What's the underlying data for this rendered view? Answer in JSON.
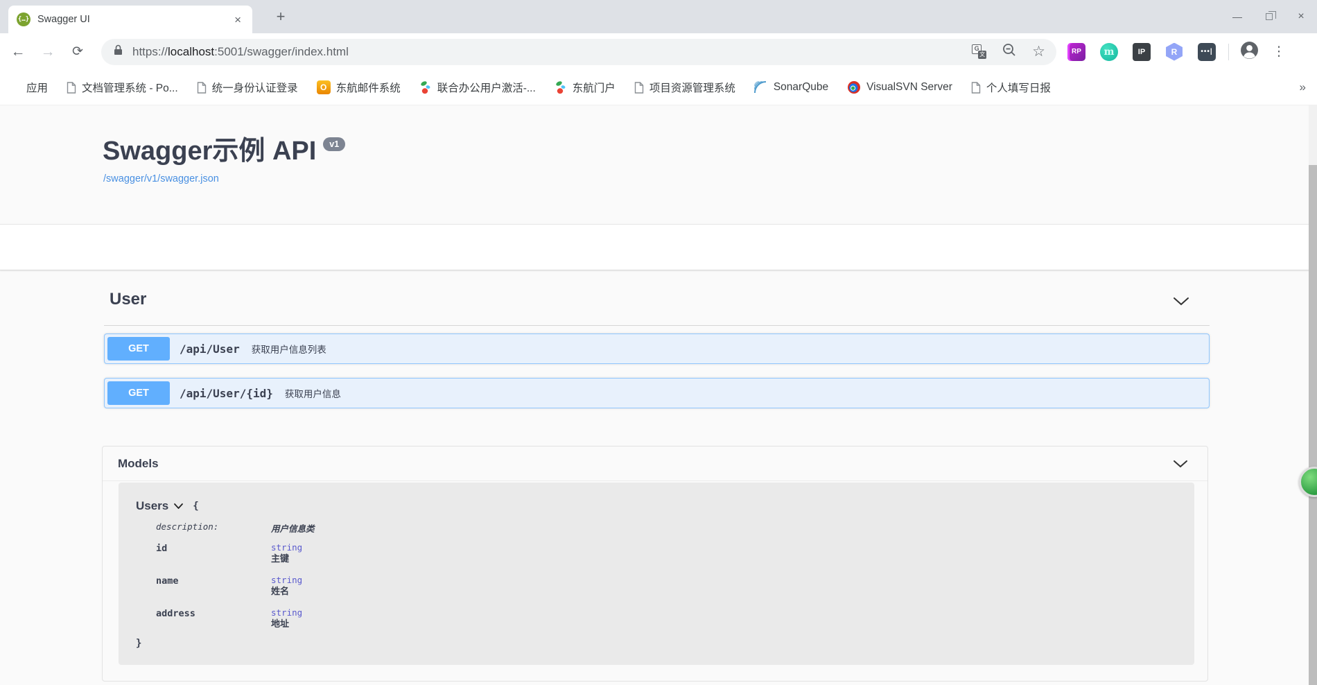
{
  "browser": {
    "tab_title": "Swagger UI",
    "url": {
      "scheme": "https://",
      "host": "localhost",
      "path": ":5001/swagger/index.html"
    },
    "bookmarks": [
      {
        "label": "应用",
        "icon": "apps-grid-icon"
      },
      {
        "label": "文档管理系统 - Po...",
        "icon": "page-icon"
      },
      {
        "label": "统一身份认证登录",
        "icon": "page-icon"
      },
      {
        "label": "东航邮件系统",
        "icon": "orange-o-icon"
      },
      {
        "label": "联合办公用户激活-...",
        "icon": "colorful-logo-icon"
      },
      {
        "label": "东航门户",
        "icon": "colorful-logo-icon"
      },
      {
        "label": "项目资源管理系统",
        "icon": "page-icon"
      },
      {
        "label": "SonarQube",
        "icon": "sonarqube-icon"
      },
      {
        "label": "VisualSVN Server",
        "icon": "visualsvn-icon"
      },
      {
        "label": "个人填写日报",
        "icon": "page-icon"
      }
    ],
    "extensions": [
      {
        "label": "RP"
      },
      {
        "label": "m"
      },
      {
        "label": "IP"
      },
      {
        "label": "R"
      },
      {
        "label": "•••|"
      }
    ]
  },
  "icons": {
    "swagger_glyph": "{…}",
    "close": "×",
    "plus": "+",
    "minimize": "—",
    "kebab": "⋮",
    "star": "☆",
    "back": "←",
    "forward": "→",
    "reload": "⟳",
    "overflow": "»"
  },
  "swagger": {
    "title": "Swagger示例 API",
    "version_badge": "v1",
    "spec_link": "/swagger/v1/swagger.json",
    "tag": {
      "name": "User"
    },
    "operations": [
      {
        "method": "GET",
        "path": "/api/User",
        "summary": "获取用户信息列表"
      },
      {
        "method": "GET",
        "path": "/api/User/{id}",
        "summary": "获取用户信息"
      }
    ],
    "models": {
      "header": "Models",
      "model_name": "Users",
      "open_brace": "{",
      "close_brace": "}",
      "description_label": "description:",
      "description_value": "用户信息类",
      "properties": [
        {
          "name": "id",
          "type": "string",
          "desc": "主键"
        },
        {
          "name": "name",
          "type": "string",
          "desc": "姓名"
        },
        {
          "name": "address",
          "type": "string",
          "desc": "地址"
        }
      ]
    }
  },
  "colors": {
    "get_method_blue": "#61affe",
    "get_row_bg": "#e8f1fc",
    "link_blue": "#4990e2",
    "heading_dark": "#3b4151",
    "prop_type_purple": "#5a5acd",
    "swagger_green": "#7ca32f",
    "version_badge_gray": "#7d8492"
  }
}
